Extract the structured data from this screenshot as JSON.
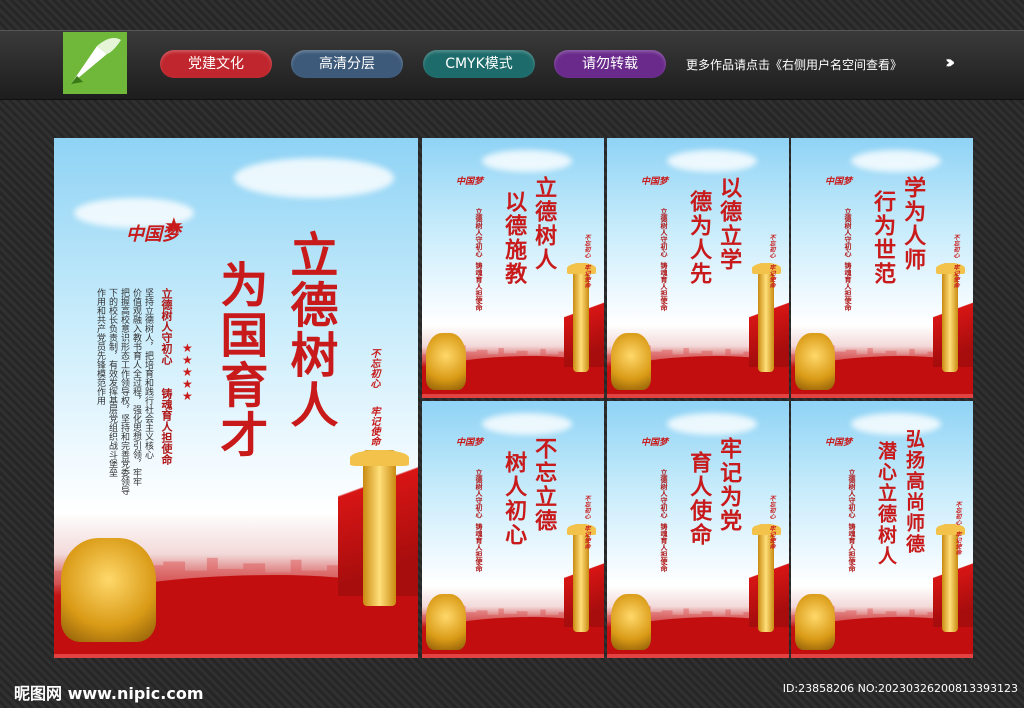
{
  "header": {
    "tags": [
      {
        "label": "党建文化",
        "color": "#c0262d"
      },
      {
        "label": "高清分层",
        "color": "#3d5a7a"
      },
      {
        "label": "CMYK模式",
        "color": "#1d6b6a"
      },
      {
        "label": "请勿转载",
        "color": "#6a2a8c"
      }
    ],
    "notice": "更多作品请点击《右侧用户名空间查看》",
    "arrow_icon": "double-chevron-right-icon",
    "logo_icon": "nipic-pen-logo"
  },
  "main_poster": {
    "emblem": "中国梦",
    "title_line1": "立德树人",
    "title_line2": "为国育才",
    "subtitle_line1": "立德树人守初心",
    "subtitle_line2": "铸魂育人担使命",
    "body_lines": [
      "坚持立德树人，把培育和践行社会主义核心",
      "价值观融入教书育人全过程，强化思想引领，牢牢",
      "把握高校意识形态工作领导权，坚持和完善党委领导",
      "下的校长负责制，有效发挥基层党组织战斗堡垒",
      "作用和共产党员先锋模范作用"
    ],
    "stamp1": "不忘初心",
    "stamp2": "牢记使命"
  },
  "small_posters": [
    {
      "line1": "立德树人",
      "line2": "以德施教"
    },
    {
      "line1": "以德立学",
      "line2": "德为人先"
    },
    {
      "line1": "学为人师",
      "line2": "行为世范"
    },
    {
      "line1": "不忘立德",
      "line2": "树人初心"
    },
    {
      "line1": "牢记为党",
      "line2": "育人使命"
    },
    {
      "line1": "弘扬高尚师德",
      "line2": "潜心立德树人"
    }
  ],
  "small_common": {
    "emblem": "中国梦",
    "subtitle_line1": "立德树人守初心",
    "subtitle_line2": "铸魂育人担使命",
    "stamp1": "不忘初心",
    "stamp2": "牢记使命"
  },
  "footer": {
    "watermark": "昵图网 www.nipic.com",
    "id_text": "ID:23858206 NO:20230326200813393123"
  }
}
